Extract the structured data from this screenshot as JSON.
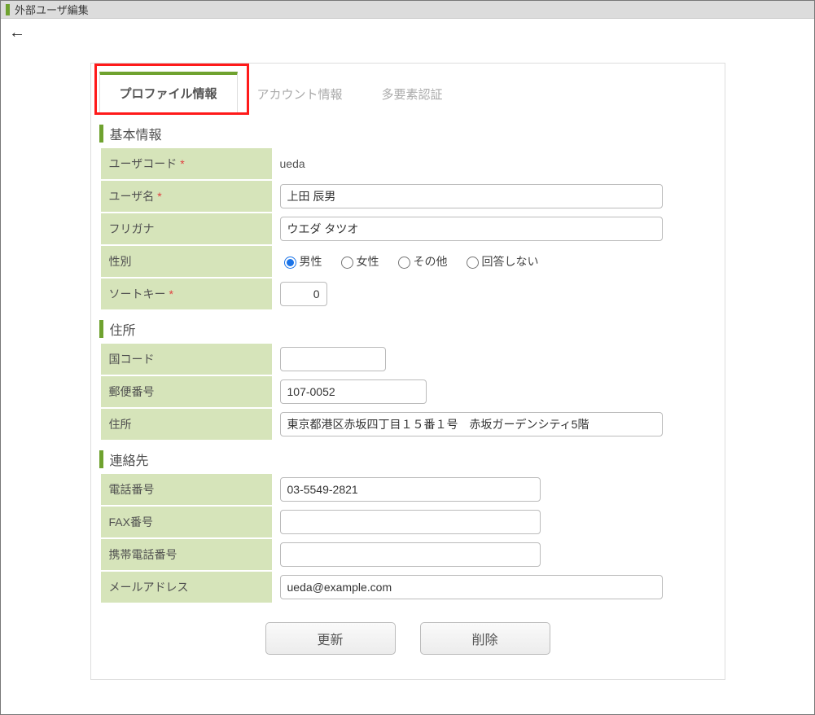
{
  "window": {
    "title": "外部ユーザ編集"
  },
  "tabs": {
    "profile": "プロファイル情報",
    "account": "アカウント情報",
    "mfa": "多要素認証",
    "active": "profile"
  },
  "sections": {
    "basic": "基本情報",
    "address": "住所",
    "contact": "連絡先"
  },
  "labels": {
    "user_code": "ユーザコード",
    "user_name": "ユーザ名",
    "furigana": "フリガナ",
    "gender": "性別",
    "sort_key": "ソートキー",
    "country_code": "国コード",
    "postal": "郵便番号",
    "address": "住所",
    "phone": "電話番号",
    "fax": "FAX番号",
    "mobile": "携帯電話番号",
    "email": "メールアドレス"
  },
  "gender_options": {
    "male": "男性",
    "female": "女性",
    "other": "その他",
    "no_answer": "回答しない",
    "selected": "male"
  },
  "values": {
    "user_code": "ueda",
    "user_name": "上田 辰男",
    "furigana": "ウエダ タツオ",
    "sort_key": "0",
    "country_code": "",
    "postal": "107-0052",
    "address": "東京都港区赤坂四丁目１５番１号　赤坂ガーデンシティ5階",
    "phone": "03-5549-2821",
    "fax": "",
    "mobile": "",
    "email": "ueda@example.com"
  },
  "buttons": {
    "update": "更新",
    "delete": "削除"
  }
}
